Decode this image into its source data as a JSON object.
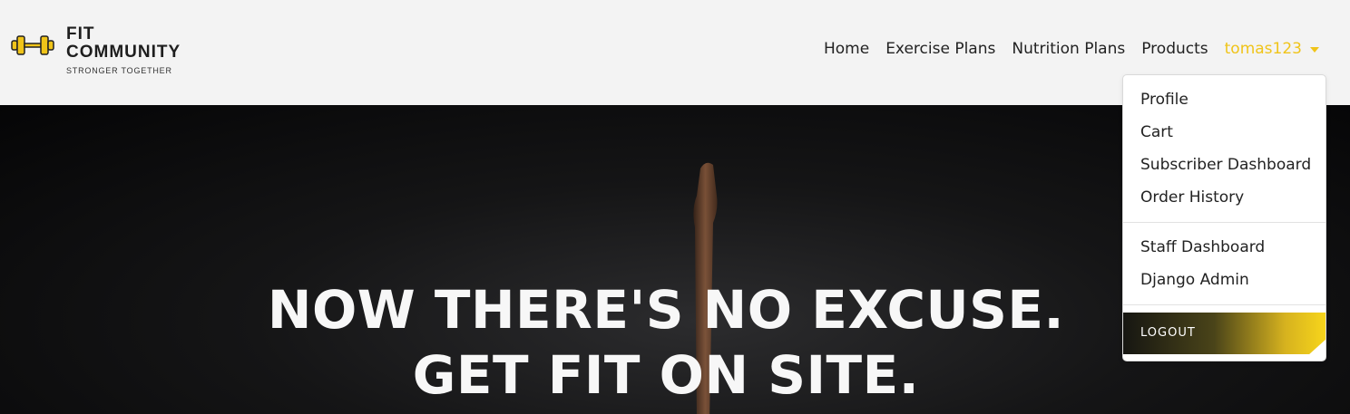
{
  "brand": {
    "title_line1": "FIT",
    "title_line2": "COMMUNITY",
    "tagline": "STRONGER TOGETHER",
    "icon": "dumbbell-icon"
  },
  "nav": {
    "items": [
      {
        "label": "Home"
      },
      {
        "label": "Exercise Plans"
      },
      {
        "label": "Nutrition Plans"
      },
      {
        "label": "Products"
      }
    ],
    "user_label": "tomas123"
  },
  "dropdown": {
    "items": [
      {
        "label": "Profile"
      },
      {
        "label": "Cart"
      },
      {
        "label": "Subscriber Dashboard"
      },
      {
        "label": "Order History"
      },
      {
        "label": "Staff Dashboard"
      },
      {
        "label": "Django Admin"
      }
    ],
    "logout_label": "LOGOUT"
  },
  "hero": {
    "line1": "NOW THERE'S NO EXCUSE.",
    "line2": "GET FIT ON SITE."
  },
  "colors": {
    "accent": "#f0c419",
    "nav_bg": "#f3f3f3",
    "hero_bg": "#0b0b0c"
  }
}
